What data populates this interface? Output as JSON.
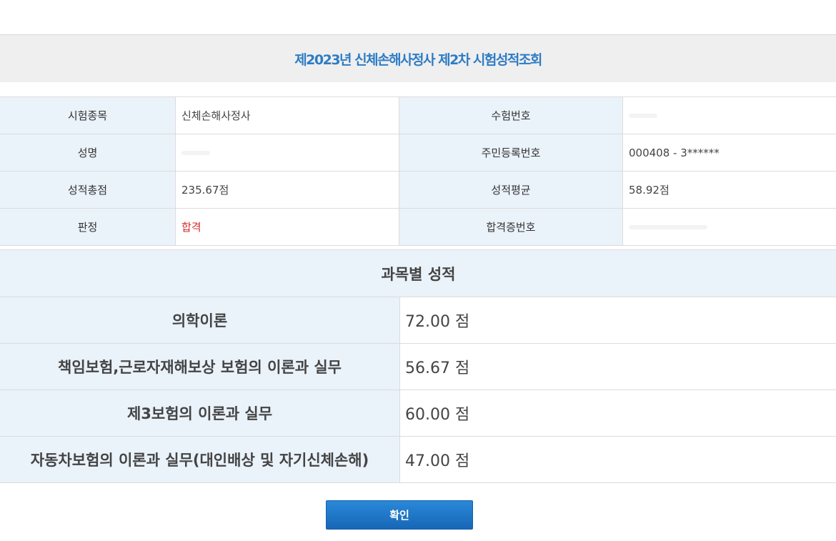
{
  "page": {
    "title": "제2023년 신체손해사정사 제2차 시험성적조회"
  },
  "info": {
    "rows": [
      {
        "label1": "시험종목",
        "value1": "신체손해사정사",
        "label2": "수험번호",
        "value2": ""
      },
      {
        "label1": "성명",
        "value1": "",
        "label2": "주민등록번호",
        "value2": "000408 - 3******"
      },
      {
        "label1": "성적총점",
        "value1": "235.67점",
        "label2": "성적평균",
        "value2": "58.92점"
      },
      {
        "label1": "판정",
        "value1": "합격",
        "label2": "합격증번호",
        "value2": ""
      }
    ]
  },
  "scores": {
    "header": "과목별 성적",
    "rows": [
      {
        "subject": "의학이론",
        "score": "72.00 점"
      },
      {
        "subject": "책임보험,근로자재해보상 보험의 이론과 실무",
        "score": "56.67 점"
      },
      {
        "subject": "제3보험의 이론과 실무",
        "score": "60.00 점"
      },
      {
        "subject": "자동차보험의 이론과 실무(대인배상 및 자기신체손해)",
        "score": "47.00 점"
      }
    ]
  },
  "buttons": {
    "confirm": "확인"
  },
  "colors": {
    "title": "#2e7cc4",
    "label_bg": "#eaf2fa",
    "pass": "#d42b2b",
    "button": "#1f78c8"
  }
}
